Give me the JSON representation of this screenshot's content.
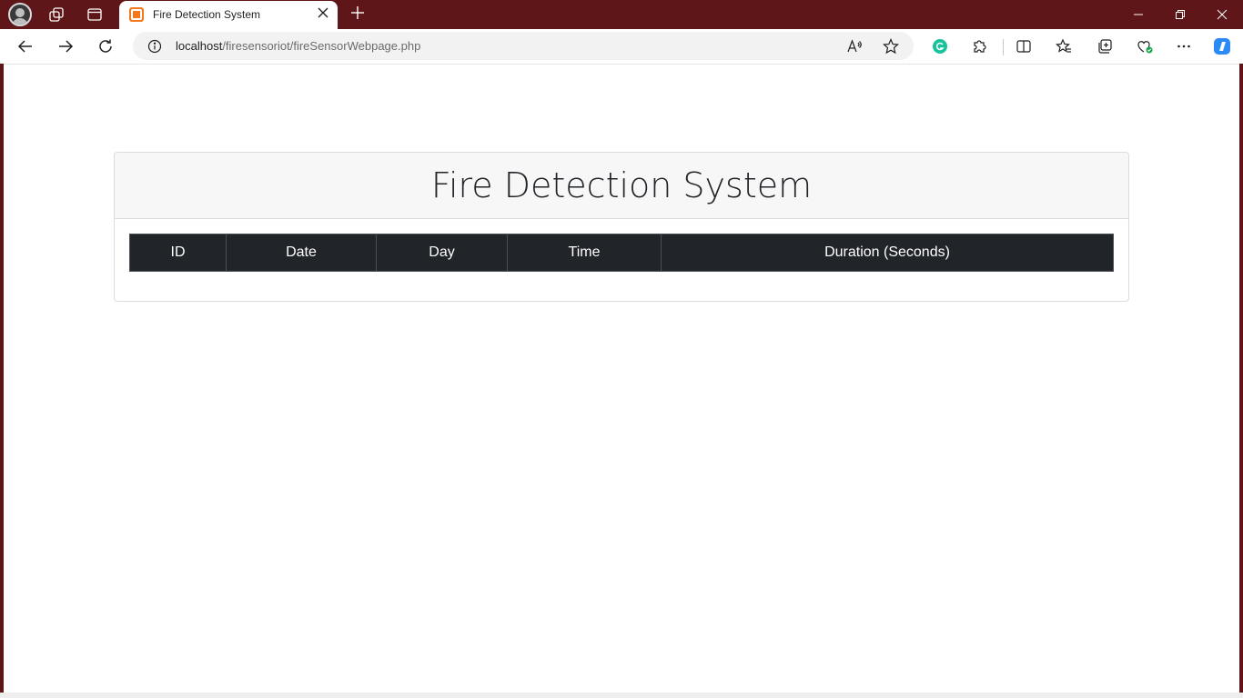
{
  "browser": {
    "tab": {
      "title": "Fire Detection System",
      "favicon": "xampp-favicon-icon"
    },
    "address": {
      "host": "localhost",
      "path": "/firesensoriot/fireSensorWebpage.php"
    },
    "colors": {
      "titlebar": "#5f1619",
      "favicon": "#f27a1d",
      "grammarly": "#15c39a"
    }
  },
  "page": {
    "title": "Fire Detection System",
    "table": {
      "headers": [
        "ID",
        "Date",
        "Day",
        "Time",
        "Duration (Seconds)"
      ],
      "rows": []
    },
    "colors": {
      "table_header_bg": "#212529",
      "card_header_bg": "#f7f7f7"
    }
  }
}
